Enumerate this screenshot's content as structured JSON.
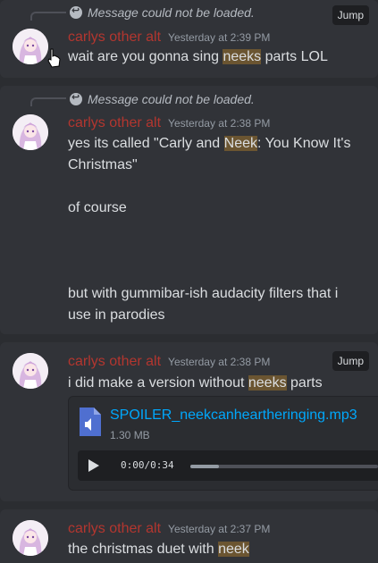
{
  "colors": {
    "author": "#b3362f",
    "highlight": "#6b5531",
    "link": "#00a8fc"
  },
  "messages": [
    {
      "reply_text": "Message could not be loaded.",
      "author": "carlys other alt",
      "timestamp": "Yesterday at 2:39 PM",
      "jump_label": "Jump",
      "parts": [
        "wait are you gonna sing ",
        "neeks",
        " parts LOL"
      ]
    },
    {
      "reply_text": "Message could not be loaded.",
      "author": "carlys other alt",
      "timestamp": "Yesterday at 2:38 PM",
      "lines": [
        [
          "yes its called \"Carly and ",
          "Neek",
          ": You Know It's Christmas\""
        ],
        [
          "of course"
        ],
        [
          "but with gummibar-ish audacity filters that i use in parodies"
        ]
      ]
    },
    {
      "author": "carlys other alt",
      "timestamp": "Yesterday at 2:38 PM",
      "jump_label": "Jump",
      "parts": [
        "i did make a version without ",
        "neeks",
        " parts"
      ],
      "attachment": {
        "icon": "audio-file-icon",
        "file_name": "SPOILER_neekcanheartheringing.mp3",
        "file_size": "1.30 MB",
        "current_time": "0:00",
        "separator": "/",
        "duration": "0:34",
        "progress": 0.15
      }
    },
    {
      "author": "carlys other alt",
      "timestamp": "Yesterday at 2:37 PM",
      "parts": [
        "the christmas duet with ",
        "neek",
        ""
      ]
    }
  ]
}
